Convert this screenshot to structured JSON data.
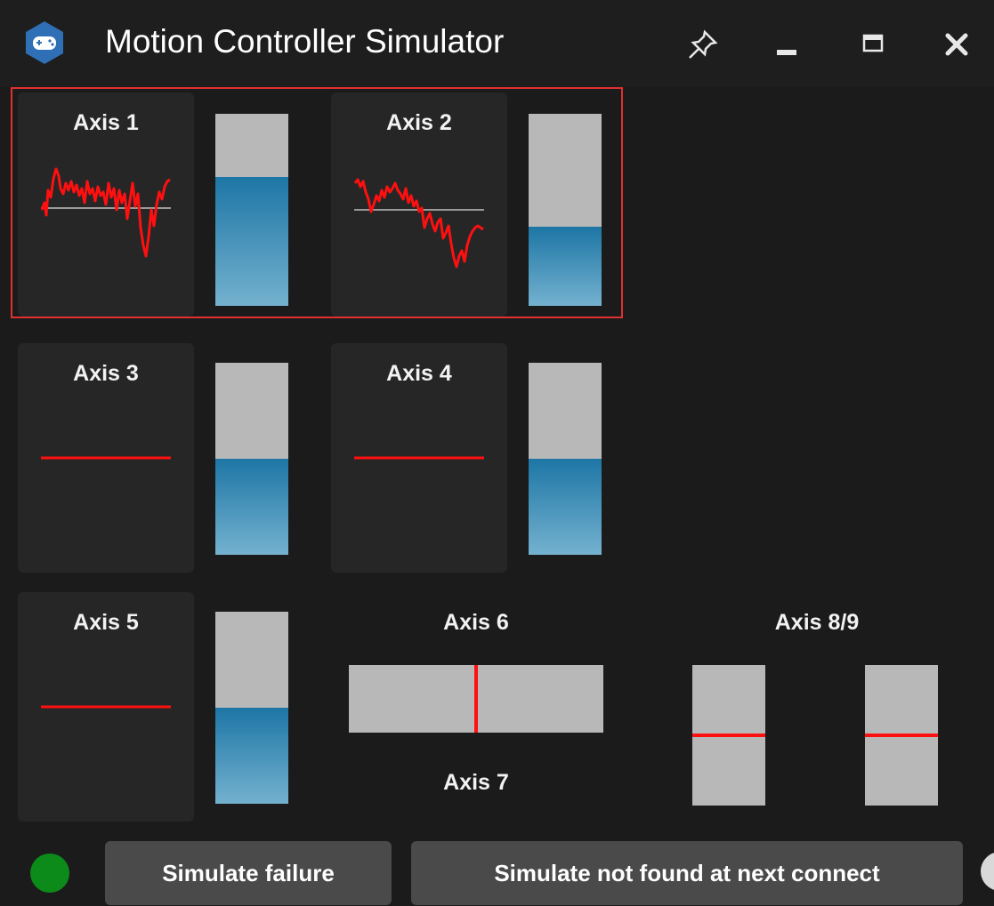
{
  "window": {
    "title": "Motion Controller Simulator",
    "icon": "gamepad-icon",
    "controls": [
      "pin-icon",
      "minimize-icon",
      "maximize-icon",
      "close-icon"
    ]
  },
  "axes": {
    "axis1": {
      "label": "Axis 1",
      "bar_level": 0.67
    },
    "axis2": {
      "label": "Axis 2",
      "bar_level": 0.41
    },
    "axis3": {
      "label": "Axis 3",
      "bar_level": 0.5
    },
    "axis4": {
      "label": "Axis 4",
      "bar_level": 0.5
    },
    "axis5": {
      "label": "Axis 5",
      "bar_level": 0.5
    },
    "axis6": {
      "label": "Axis 6",
      "level": 0.5
    },
    "axis7": {
      "label": "Axis 7"
    },
    "axis89": {
      "label": "Axis 8/9",
      "left_level": 0.5,
      "right_level": 0.5
    }
  },
  "footer": {
    "status_color": "#0c8a1a",
    "simulate_failure": "Simulate failure",
    "simulate_not_found": "Simulate not found at next connect"
  },
  "colors": {
    "highlight": "#e03030",
    "trace": "#ff1010",
    "bar_fill": "#1d76a5",
    "bar_track": "#b8b8b8"
  }
}
